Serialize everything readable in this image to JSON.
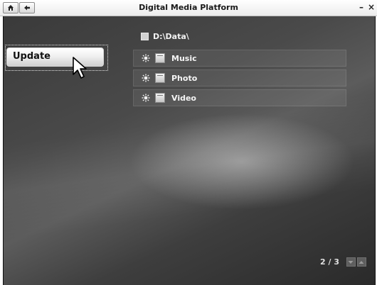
{
  "window": {
    "title": "Digital Media Platform",
    "minimize_label": "–",
    "close_label": "×"
  },
  "toolbar": {
    "home_icon": "home-icon",
    "back_icon": "back-arrow-icon"
  },
  "sidebar": {
    "update_label": "Update"
  },
  "path": {
    "label": "D:\\Data\\"
  },
  "folders": [
    {
      "label": "Music"
    },
    {
      "label": "Photo"
    },
    {
      "label": "Video"
    }
  ],
  "pager": {
    "text": "2 / 3"
  },
  "colors": {
    "stage_dark": "#2a2a2a",
    "stage_mid": "#5c5c5c",
    "text": "#f2f2f2"
  }
}
